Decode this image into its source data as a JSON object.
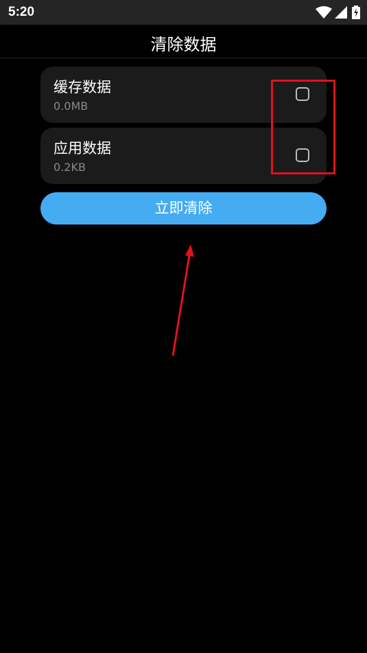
{
  "status_bar": {
    "time": "5:20",
    "icons": [
      "wifi-icon",
      "signal-icon",
      "battery-charging-icon"
    ]
  },
  "header": {
    "title": "清除数据"
  },
  "items": [
    {
      "title": "缓存数据",
      "size": "0.0MB",
      "checked": false
    },
    {
      "title": "应用数据",
      "size": "0.2KB",
      "checked": false
    }
  ],
  "actions": {
    "clear_label": "立即清除"
  },
  "colors": {
    "accent": "#45acf2",
    "annotation": "#e2121b",
    "card": "#1b1b1b",
    "background": "#000000"
  }
}
